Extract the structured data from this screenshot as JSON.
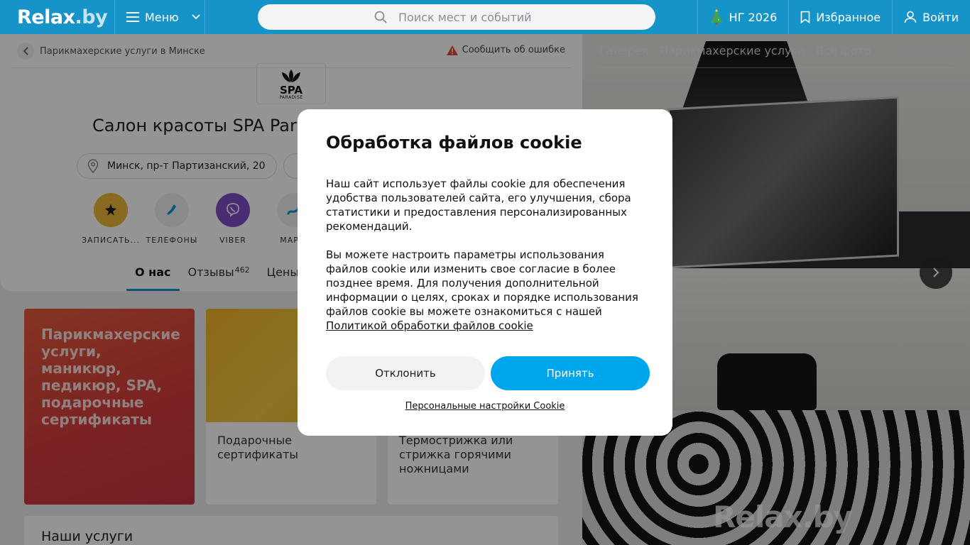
{
  "header": {
    "logo_main": "Relax",
    "logo_suffix": ".by",
    "menu_label": "Меню",
    "search_placeholder": "Поиск мест и событий",
    "ng_label": "НГ 2026",
    "favorites_label": "Избранное",
    "login_label": "Войти"
  },
  "breadcrumb": {
    "label": "Парикмахерские услуги в Минске",
    "report_label": "Сообщить об ошибке"
  },
  "venue": {
    "logo_text": "SPA",
    "logo_sub": "PARADISE",
    "title": "Салон красоты SPA Par",
    "address": "Минск, пр-т Партизанский, 20"
  },
  "actions": [
    {
      "label": "ЗАПИСАТЬ...",
      "icon": "booking-icon",
      "color": "#e8b636"
    },
    {
      "label": "ТЕЛЕФОНЫ",
      "icon": "phone-icon",
      "color": "#eceef0"
    },
    {
      "label": "VIBER",
      "icon": "viber-icon",
      "color": "#7d4fc6"
    },
    {
      "label": "МАРШ",
      "icon": "route-icon",
      "color": "#eceef0"
    }
  ],
  "tabs": [
    {
      "label": "О нас",
      "active": true
    },
    {
      "label": "Отзывы",
      "badge": "462"
    },
    {
      "label": "Цены"
    }
  ],
  "promo_text": "Парикмахерские услуги, маникюр, педикюр, SPA, подарочные сертификаты",
  "cards": [
    {
      "caption": "Подарочные сертификаты"
    },
    {
      "caption": "Термострижка или стрижка горячими ножницами"
    }
  ],
  "services_title": "Наши услуги",
  "gallery": {
    "tabs": [
      "Галерея",
      "Парикмахерские услуги",
      "Все фото"
    ],
    "watermark": "Relax.by"
  },
  "cookie": {
    "title": "Обработка файлов cookie",
    "p1": "Наш сайт использует файлы cookie для обеспечения удобства пользователей сайта, его улучшения, сбора статистики и предоставления персонализированных рекомендаций.",
    "p2": "Вы можете настроить параметры использования файлов cookie или изменить свое согласие в более позднее время. Для получения дополнительной информации о целях, сроках и порядке использования файлов cookie вы можете ознакомиться с нашей",
    "policy_link": "Политикой обработки файлов cookie",
    "decline": "Отклонить",
    "accept": "Принять",
    "settings": "Персональные настройки Cookie"
  }
}
